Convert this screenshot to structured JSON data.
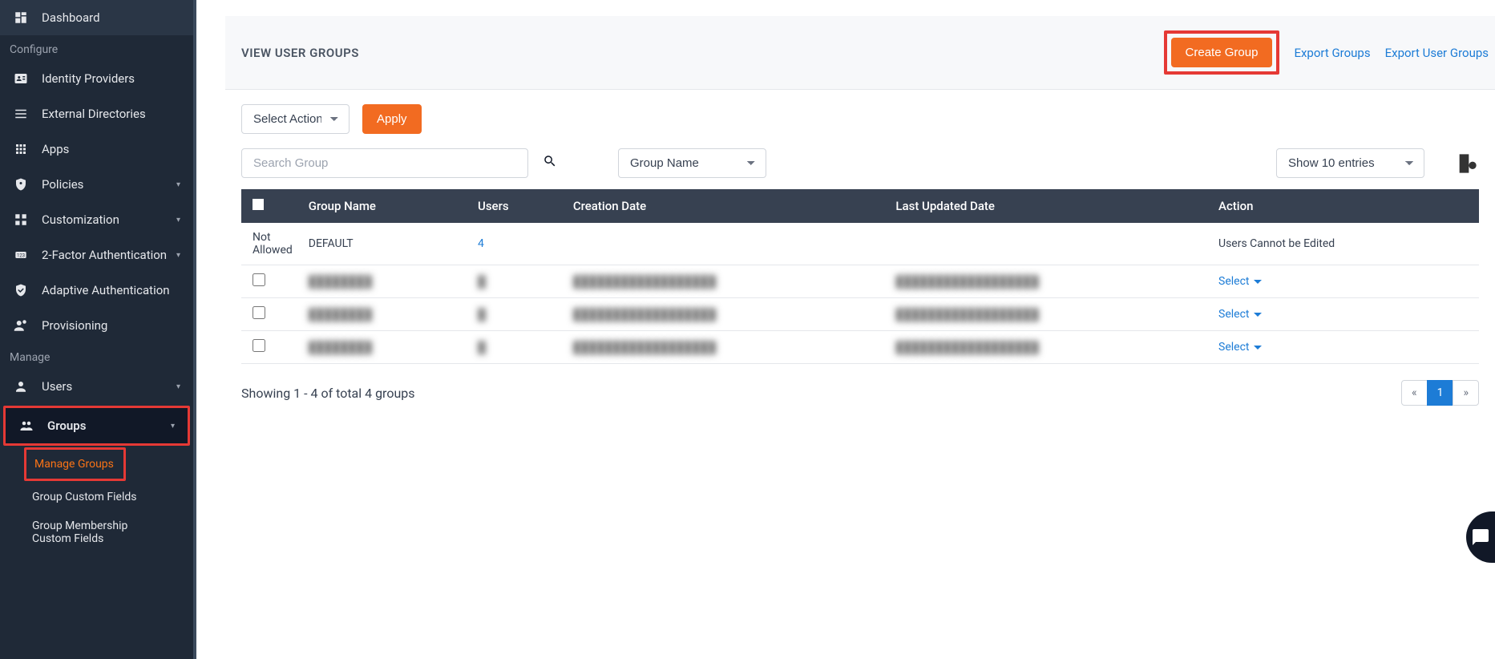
{
  "sidebar": {
    "dashboard": "Dashboard",
    "section_configure": "Configure",
    "identity_providers": "Identity Providers",
    "external_directories": "External Directories",
    "apps": "Apps",
    "policies": "Policies",
    "customization": "Customization",
    "two_factor": "2-Factor Authentication",
    "adaptive_auth": "Adaptive Authentication",
    "provisioning": "Provisioning",
    "section_manage": "Manage",
    "users": "Users",
    "groups": "Groups",
    "manage_groups": "Manage Groups",
    "group_custom_fields": "Group Custom Fields",
    "group_membership_custom_fields": "Group Membership Custom Fields"
  },
  "header": {
    "title": "VIEW USER GROUPS",
    "create_group": "Create Group",
    "export_groups": "Export Groups",
    "export_user_groups": "Export User Groups"
  },
  "toolbar": {
    "select_action": "Select Action",
    "apply": "Apply",
    "search_placeholder": "Search Group",
    "filter_by": "Group Name",
    "show_entries": "Show 10 entries"
  },
  "table": {
    "columns": {
      "group_name": "Group Name",
      "users": "Users",
      "creation_date": "Creation Date",
      "last_updated": "Last Updated Date",
      "action": "Action"
    },
    "rows": [
      {
        "checkbox": "Not Allowed",
        "group_name": "DEFAULT",
        "users": "4",
        "users_link": true,
        "creation_date": "",
        "last_updated": "",
        "action": "Users Cannot be Edited",
        "action_link": false,
        "blur": false
      },
      {
        "checkbox": "",
        "group_name": "████████",
        "users": "█",
        "users_link": false,
        "creation_date": "██████████████████",
        "last_updated": "██████████████████",
        "action": "Select",
        "action_link": true,
        "blur": true
      },
      {
        "checkbox": "",
        "group_name": "████████",
        "users": "█",
        "users_link": false,
        "creation_date": "██████████████████",
        "last_updated": "██████████████████",
        "action": "Select",
        "action_link": true,
        "blur": true
      },
      {
        "checkbox": "",
        "group_name": "████████",
        "users": "█",
        "users_link": false,
        "creation_date": "██████████████████",
        "last_updated": "██████████████████",
        "action": "Select",
        "action_link": true,
        "blur": true
      }
    ]
  },
  "footer": {
    "showing": "Showing 1 - 4 of total 4 groups",
    "prev": "«",
    "page": "1",
    "next": "»"
  }
}
